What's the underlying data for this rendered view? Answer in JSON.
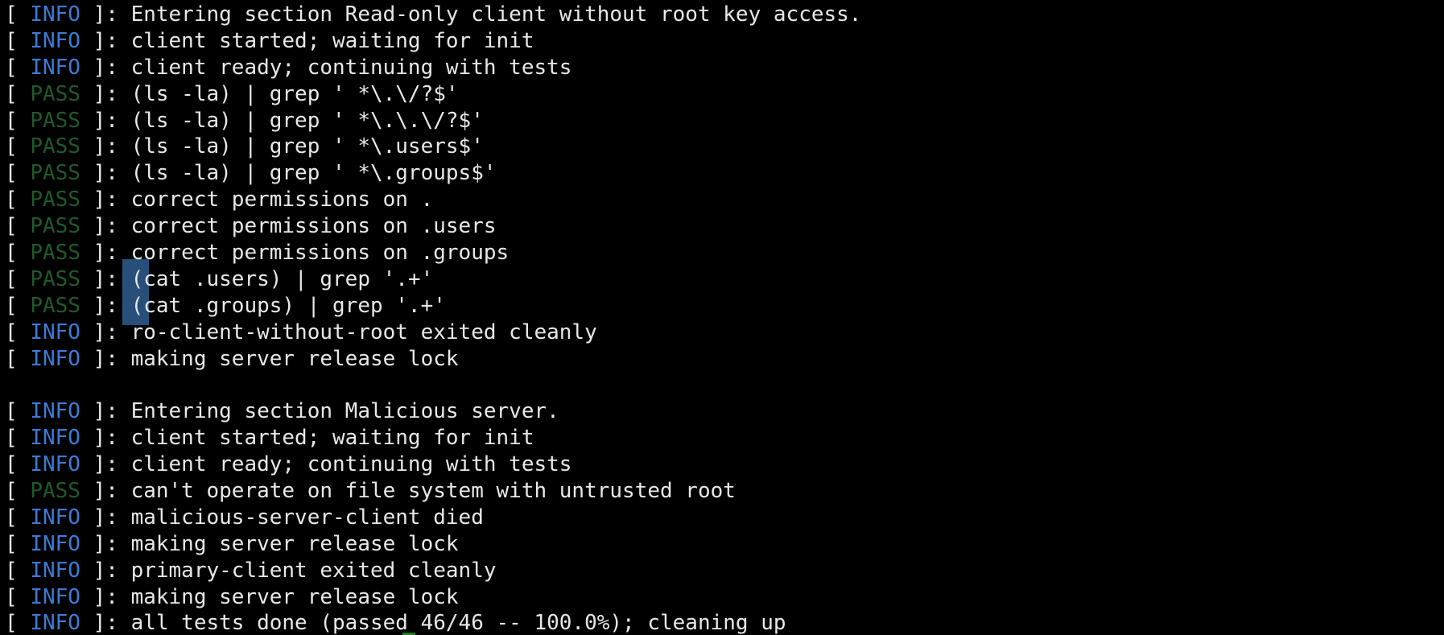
{
  "terminal": {
    "colors": {
      "background": "#000000",
      "text": "#e8e8e8",
      "info": "#3d7bd6",
      "pass": "#1f5a2a",
      "selection": "#2e5d8f"
    },
    "lines": [
      {
        "level": "INFO",
        "text": "Entering section Read-only client without root key access."
      },
      {
        "level": "INFO",
        "text": "client started; waiting for init"
      },
      {
        "level": "INFO",
        "text": "client ready; continuing with tests"
      },
      {
        "level": "PASS",
        "text": "(ls -la) | grep ' *\\.\\/?$'"
      },
      {
        "level": "PASS",
        "text": "(ls -la) | grep ' *\\.\\.\\/?$'"
      },
      {
        "level": "PASS",
        "text": "(ls -la) | grep ' *\\.users$'"
      },
      {
        "level": "PASS",
        "text": "(ls -la) | grep ' *\\.groups$'"
      },
      {
        "level": "PASS",
        "text": "correct permissions on ."
      },
      {
        "level": "PASS",
        "text": "correct permissions on .users"
      },
      {
        "level": "PASS",
        "text": "correct permissions on .groups"
      },
      {
        "level": "PASS",
        "text": "(cat .users) | grep '.+'"
      },
      {
        "level": "PASS",
        "text": "(cat .groups) | grep '.+'"
      },
      {
        "level": "INFO",
        "text": "ro-client-without-root exited cleanly"
      },
      {
        "level": "INFO",
        "text": "making server release lock"
      },
      {
        "level": "",
        "text": ""
      },
      {
        "level": "INFO",
        "text": "Entering section Malicious server."
      },
      {
        "level": "INFO",
        "text": "client started; waiting for init"
      },
      {
        "level": "INFO",
        "text": "client ready; continuing with tests"
      },
      {
        "level": "PASS",
        "text": "can't operate on file system with untrusted root"
      },
      {
        "level": "INFO",
        "text": "malicious-server-client died"
      },
      {
        "level": "INFO",
        "text": "making server release lock"
      },
      {
        "level": "INFO",
        "text": "primary-client exited cleanly"
      },
      {
        "level": "INFO",
        "text": "making server release lock"
      },
      {
        "level": "INFO",
        "text": "all tests done (passed 46/46 -- 100.0%); cleaning up"
      }
    ]
  }
}
